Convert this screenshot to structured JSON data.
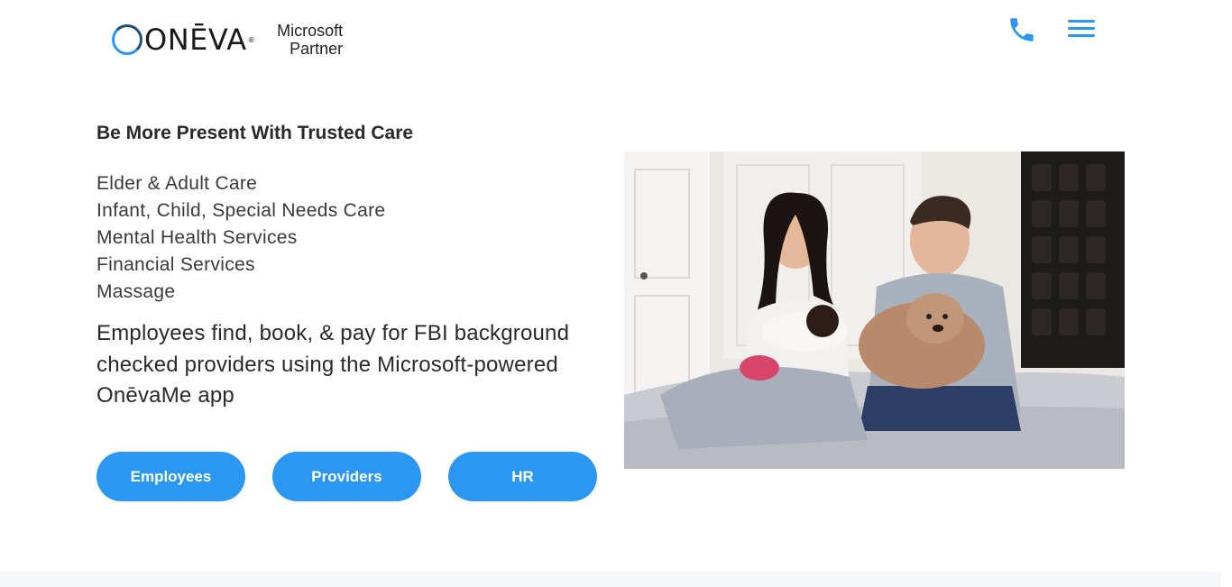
{
  "header": {
    "logo_text": "ONĒVA",
    "logo_trademark": "®",
    "partner_line1": "Microsoft",
    "partner_line2": "Partner",
    "phone_icon": "phone-icon",
    "menu_icon": "hamburger-menu-icon"
  },
  "hero": {
    "heading": "Be More Present With Trusted Care",
    "services": [
      "Elder & Adult Care",
      "Infant, Child, Special Needs Care",
      "Mental Health Services",
      "Financial Services",
      "Massage"
    ],
    "tagline": "Employees find, book, & pay for FBI background checked providers using the Microsoft-powered OnēvaMe app",
    "buttons": {
      "employees": "Employees",
      "providers": "Providers",
      "hr": "HR"
    }
  },
  "colors": {
    "accent": "#2b97f0",
    "text": "#2a2a2a",
    "footer_band": "#f6f7fb"
  }
}
